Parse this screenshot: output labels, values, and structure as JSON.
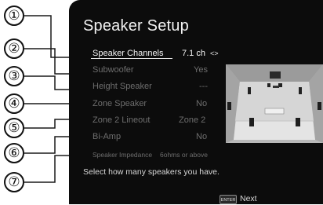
{
  "callouts": [
    "①",
    "②",
    "③",
    "④",
    "⑤",
    "⑥",
    "⑦"
  ],
  "title": "Speaker Setup",
  "settings": [
    {
      "label": "Speaker Channels",
      "value": "7.1 ch",
      "arrows": "<>"
    },
    {
      "label": "Subwoofer",
      "value": "Yes"
    },
    {
      "label": "Height Speaker",
      "value": "---"
    },
    {
      "label": "Zone Speaker",
      "value": "No"
    },
    {
      "label": "Zone 2 Lineout",
      "value": "Zone 2"
    },
    {
      "label": "Bi-Amp",
      "value": "No"
    },
    {
      "label": "Speaker Impedance",
      "value": "6ohms or above"
    }
  ],
  "help_text": "Select how many speakers you have.",
  "footer": {
    "enter_label": "ENTER",
    "next_label": "Next"
  },
  "colors": {
    "active_text": "#f4f4f4",
    "inactive_text": "#6e6e6e",
    "screen_bg": "#0c0c0c"
  },
  "icons": {
    "arrows": "left-right-arrows-icon",
    "enter": "enter-key-icon"
  }
}
